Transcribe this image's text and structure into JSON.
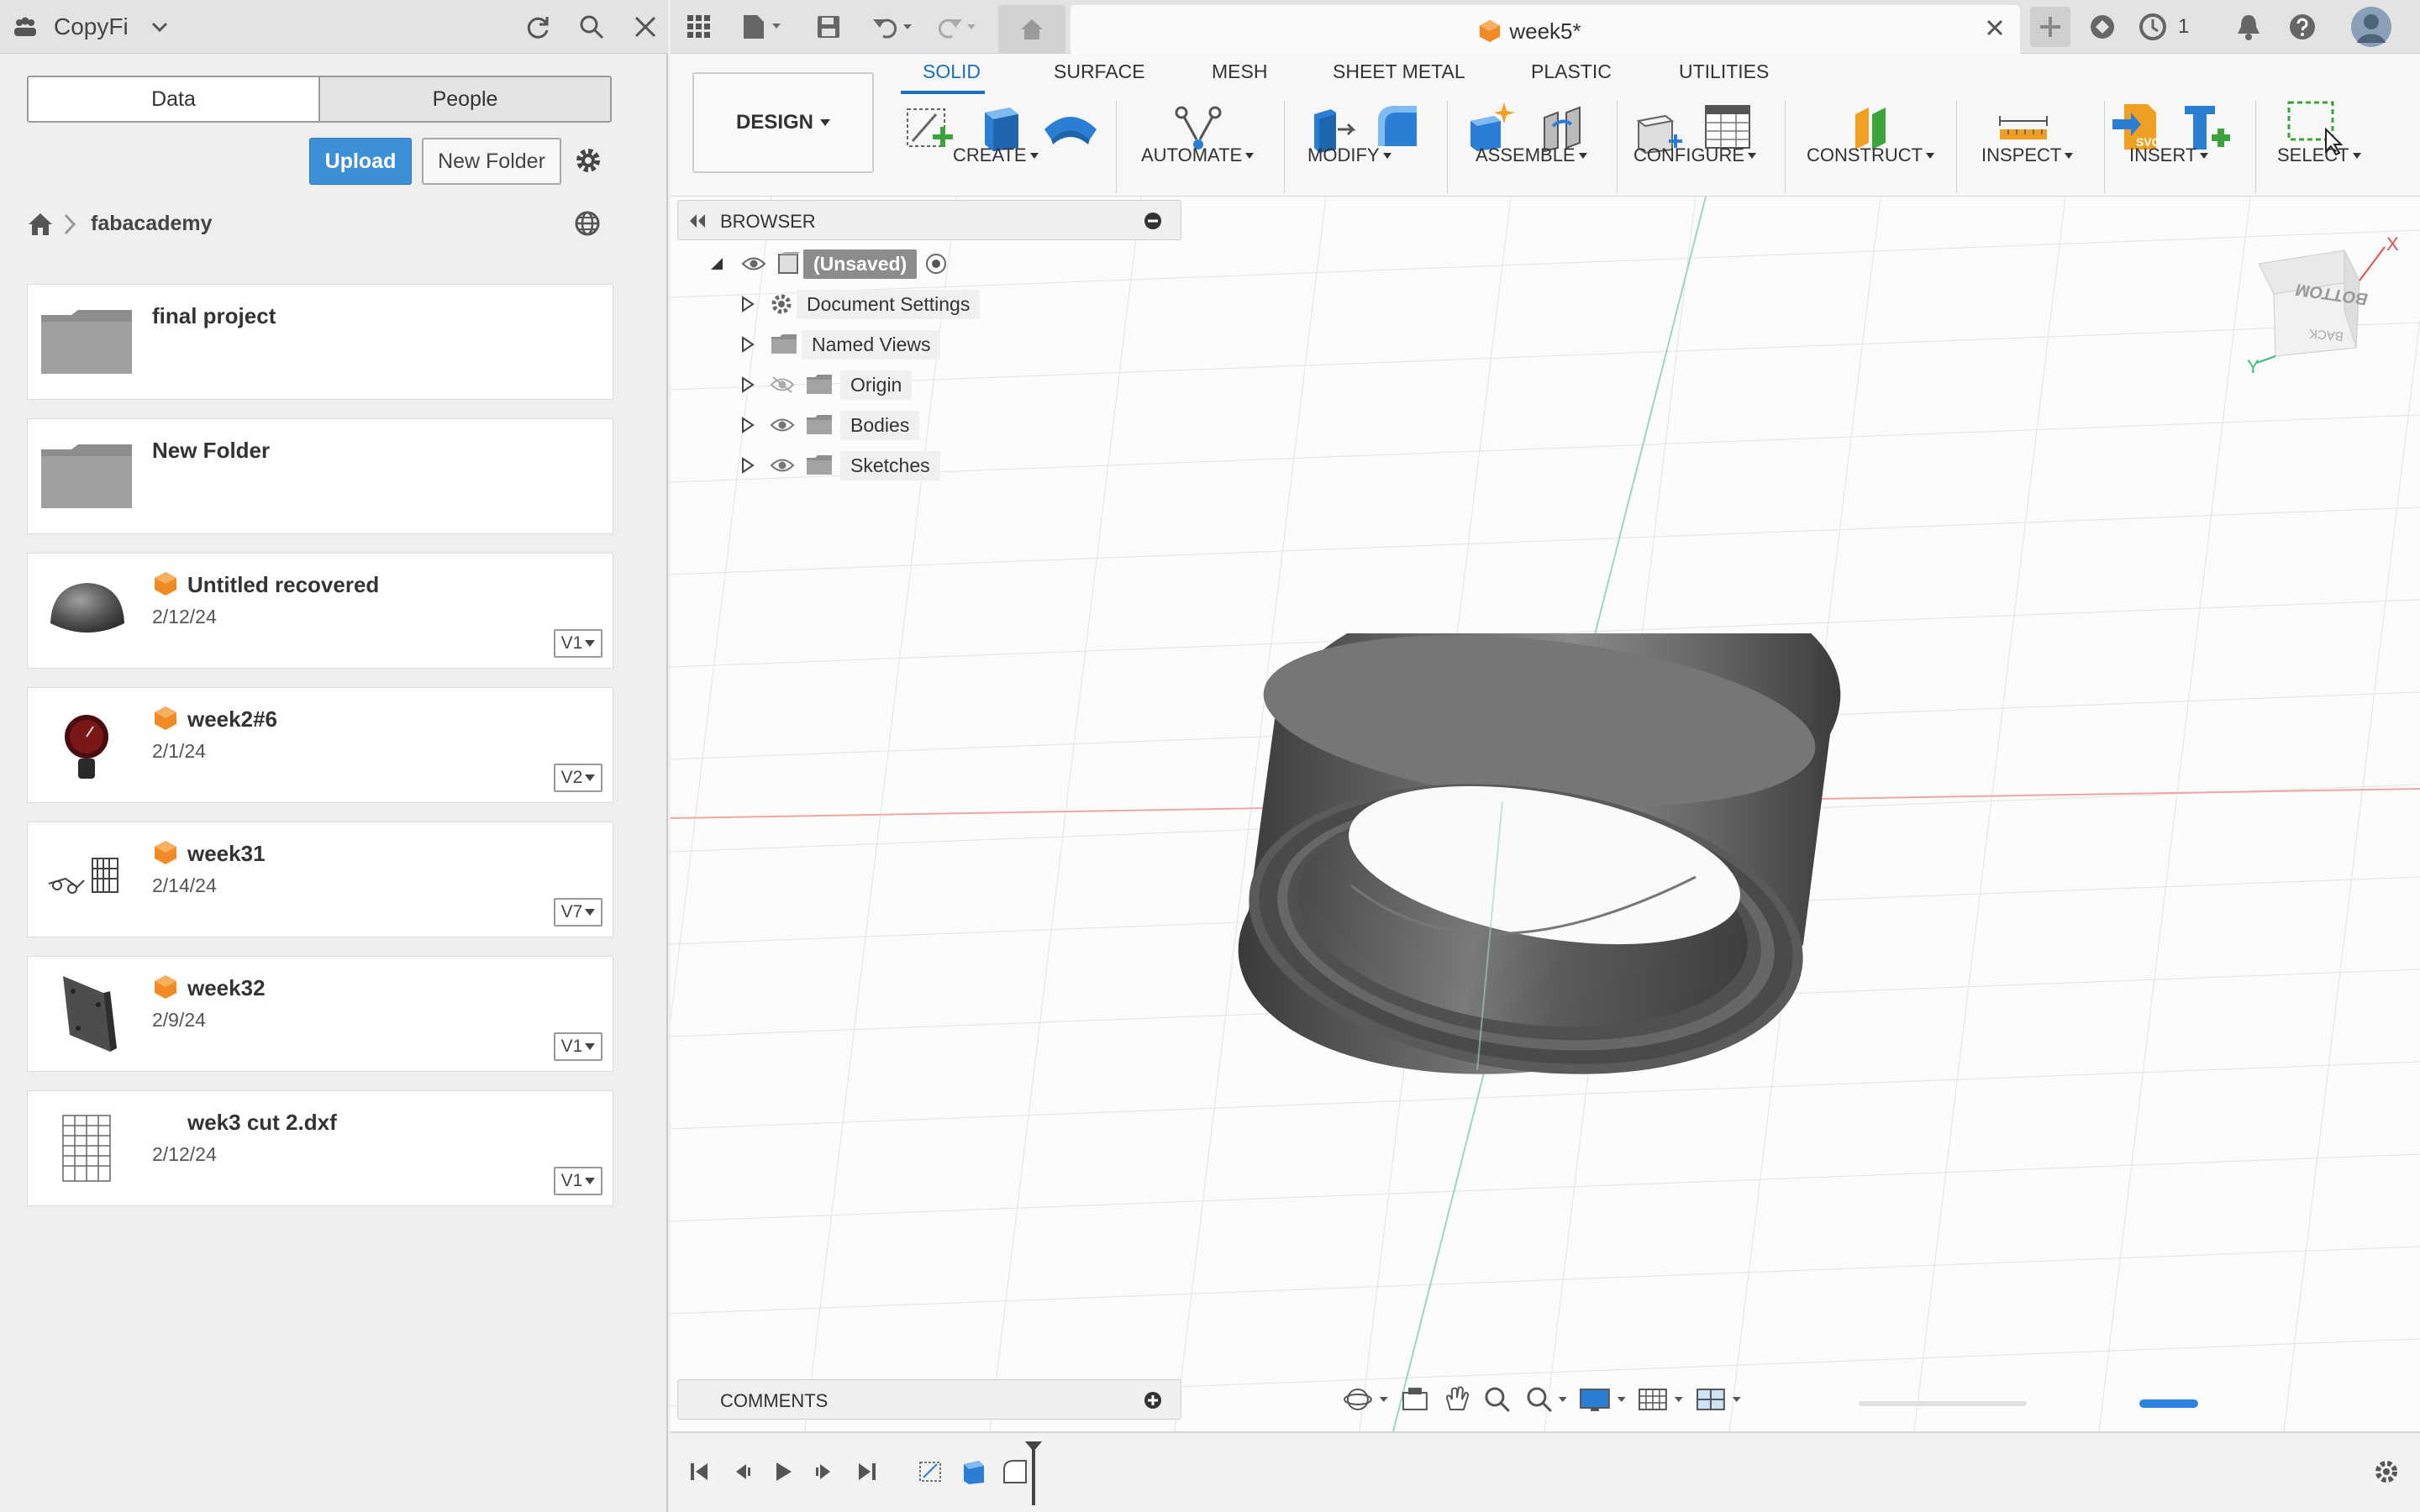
{
  "data_panel": {
    "team_name": "CopyFi",
    "tabs": [
      "Data",
      "People"
    ],
    "upload_label": "Upload",
    "new_folder_label": "New Folder",
    "breadcrumb_project": "fabacademy",
    "items": [
      {
        "title": "final project",
        "type": "folder"
      },
      {
        "title": "New Folder",
        "type": "folder"
      },
      {
        "title": "Untitled recovered",
        "date": "2/12/24",
        "version": "V1",
        "type": "design"
      },
      {
        "title": "week2#6",
        "date": "2/1/24",
        "version": "V2",
        "type": "design"
      },
      {
        "title": "week31",
        "date": "2/14/24",
        "version": "V7",
        "type": "design"
      },
      {
        "title": "week32",
        "date": "2/9/24",
        "version": "V1",
        "type": "design"
      },
      {
        "title": "wek3 cut 2.dxf",
        "date": "2/12/24",
        "version": "V1",
        "type": "dxf"
      }
    ]
  },
  "app": {
    "doc_title": "week5*",
    "job_count": "1"
  },
  "ribbon": {
    "workspace": "DESIGN",
    "tabs": [
      "SOLID",
      "SURFACE",
      "MESH",
      "SHEET METAL",
      "PLASTIC",
      "UTILITIES"
    ],
    "groups": [
      "CREATE",
      "AUTOMATE",
      "MODIFY",
      "ASSEMBLE",
      "CONFIGURE",
      "CONSTRUCT",
      "INSPECT",
      "INSERT",
      "SELECT"
    ]
  },
  "browser": {
    "title": "BROWSER",
    "root": "(Unsaved)",
    "nodes": [
      "Document Settings",
      "Named Views",
      "Origin",
      "Bodies",
      "Sketches"
    ]
  },
  "viewcube": {
    "face_top": "BOTTOM",
    "face_side": "BACK",
    "axis_x": "X",
    "axis_y": "Y"
  },
  "comments_label": "COMMENTS",
  "colors": {
    "accent": "#1a6fc0",
    "upload": "#3d8fd6",
    "design_icon": "#f08a24"
  }
}
